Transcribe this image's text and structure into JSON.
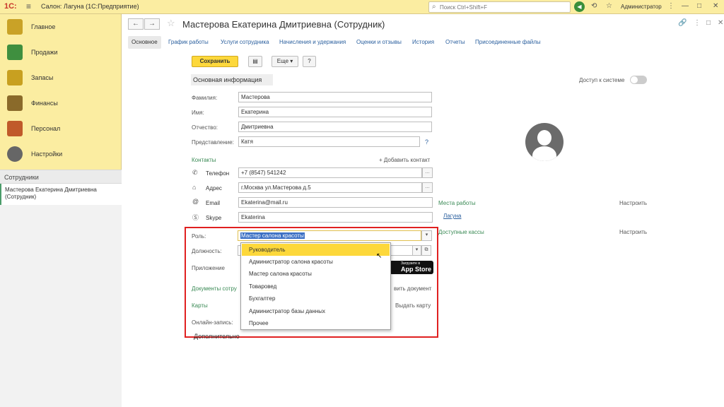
{
  "topbar": {
    "logo": "1С:",
    "title": "Салон: Лагуна  (1С:Предприятие)",
    "search_placeholder": "Поиск Ctrl+Shift+F",
    "user": "Администратор"
  },
  "sidebar": {
    "items": [
      {
        "label": "Главное",
        "color": "#c9a227"
      },
      {
        "label": "Продажи",
        "color": "#3f8f3f"
      },
      {
        "label": "Запасы",
        "color": "#c8a020"
      },
      {
        "label": "Финансы",
        "color": "#8a6a2a"
      },
      {
        "label": "Персонал",
        "color": "#c05a2a"
      },
      {
        "label": "Настройки",
        "color": "#666666"
      }
    ],
    "section_label": "Сотрудники",
    "current_item": "Мастерова Екатерина Дмитриевна (Сотрудник)"
  },
  "header": {
    "title": "Мастерова Екатерина Дмитриевна (Сотрудник)"
  },
  "tabs": [
    "Основное",
    "График работы",
    "Услуги сотрудника",
    "Начисления и удержания",
    "Оценки и отзывы",
    "История",
    "Отчеты",
    "Присоединенные файлы"
  ],
  "toolbar": {
    "save": "Сохранить",
    "more": "Еще",
    "help": "?"
  },
  "main_info": {
    "header": "Основная информация",
    "access_label": "Доступ к системе",
    "fields": {
      "surname_label": "Фамилия:",
      "surname": "Мастерова",
      "name_label": "Имя:",
      "name": "Екатерина",
      "patronymic_label": "Отчество:",
      "patronymic": "Дмитриевна",
      "representation_label": "Представление:",
      "representation": "Катя"
    },
    "help_mark": "?"
  },
  "contacts": {
    "header": "Контакты",
    "add": "+ Добавить контакт",
    "phone_label": "Телефон",
    "phone": "+7 (8547) 541242",
    "address_label": "Адрес",
    "address": "г.Москва ул.Мастерова д.5",
    "email_label": "Email",
    "email": "Ekaterina@mail.ru",
    "skype_label": "Skype",
    "skype": "Ekaterina"
  },
  "work_places": {
    "header": "Места работы",
    "configure": "Настроить",
    "item": "Лагуна"
  },
  "cash_desks": {
    "header": "Доступные кассы",
    "configure": "Настроить"
  },
  "role": {
    "label": "Роль:",
    "value": "Мастер салона красоты",
    "options": [
      "Руководитель",
      "Администратор салона красоты",
      "Мастер салона красоты",
      "Товаровед",
      "Бухгалтер",
      "Администратор базы данных",
      "Прочее"
    ]
  },
  "position_label": "Должность:",
  "app_label": "Приложение",
  "appstore": {
    "small": "Загрузите в",
    "big": "App Store"
  },
  "documents": {
    "header": "Документы сотру",
    "add": "вить документ"
  },
  "cards": {
    "header": "Карты",
    "issue": "Выдать карту"
  },
  "online_label": "Онлайн-запись:",
  "additional": "Дополнительно"
}
